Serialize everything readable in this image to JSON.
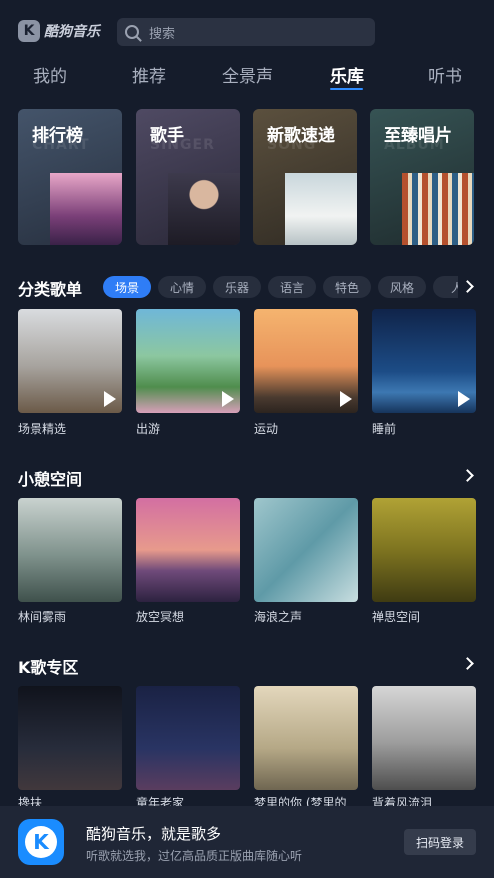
{
  "header": {
    "logo_text": "酷狗音乐",
    "logo_mark": "K",
    "search_placeholder": "搜索"
  },
  "tabs": [
    {
      "label": "我的",
      "active": false
    },
    {
      "label": "推荐",
      "active": false
    },
    {
      "label": "全景声",
      "active": false
    },
    {
      "label": "乐库",
      "active": true
    },
    {
      "label": "听书",
      "active": false
    }
  ],
  "feature_cards": [
    {
      "title": "排行榜",
      "watermark": "CHART"
    },
    {
      "title": "歌手",
      "watermark": "SINGER"
    },
    {
      "title": "新歌速递",
      "watermark": "SONG"
    },
    {
      "title": "至臻唱片",
      "watermark": "ALBUM"
    }
  ],
  "categories": {
    "title": "分类歌单",
    "chips": [
      {
        "label": "场景",
        "active": true
      },
      {
        "label": "心情",
        "active": false
      },
      {
        "label": "乐器",
        "active": false
      },
      {
        "label": "语言",
        "active": false
      },
      {
        "label": "特色",
        "active": false
      },
      {
        "label": "风格",
        "active": false
      },
      {
        "label": "人",
        "active": false
      }
    ],
    "items": [
      {
        "label": "场景精选"
      },
      {
        "label": "出游"
      },
      {
        "label": "运动"
      },
      {
        "label": "睡前"
      }
    ]
  },
  "relax_space": {
    "title": "小憩空间",
    "items": [
      {
        "label": "林间雾雨"
      },
      {
        "label": "放空冥想"
      },
      {
        "label": "海浪之声"
      },
      {
        "label": "禅思空间"
      }
    ]
  },
  "karaoke": {
    "title": "K歌专区",
    "items": [
      {
        "label": "搀扶"
      },
      {
        "label": "童年老家"
      },
      {
        "label": "梦里的你 (梦里的"
      },
      {
        "label": "背着风流泪"
      }
    ]
  },
  "banner": {
    "title": "酷狗音乐，就是歌多",
    "subtitle": "听歌就选我，过亿高品质正版曲库随心听",
    "button": "扫码登录",
    "icon_mark": "K"
  }
}
